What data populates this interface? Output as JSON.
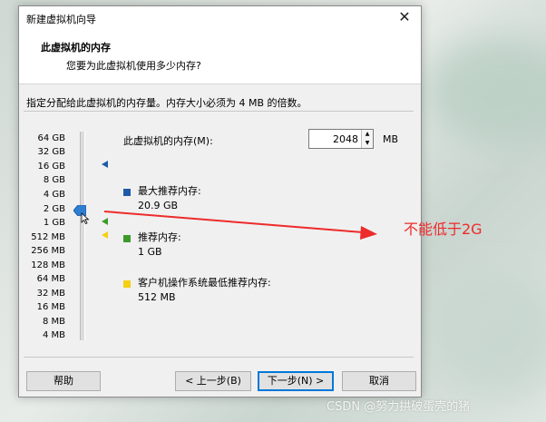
{
  "window": {
    "title": "新建虚拟机向导"
  },
  "header": {
    "title": "此虚拟机的内存",
    "subtitle": "您要为此虚拟机使用多少内存?"
  },
  "instruction": "指定分配给此虚拟机的内存量。内存大小必须为 4 MB 的倍数。",
  "scale_labels": [
    "64 GB",
    "32 GB",
    "16 GB",
    "8 GB",
    "4 GB",
    "2 GB",
    "1 GB",
    "512 MB",
    "256 MB",
    "128 MB",
    "64 MB",
    "32 MB",
    "16 MB",
    "8 MB",
    "4 MB"
  ],
  "memory": {
    "label": "此虚拟机的内存(M):",
    "value": "2048",
    "unit": "MB"
  },
  "legend": [
    {
      "label": "最大推荐内存:",
      "value": "20.9 GB",
      "color": "#1e5aa8"
    },
    {
      "label": "推荐内存:",
      "value": "1 GB",
      "color": "#3c9a2b"
    },
    {
      "label": "客户机操作系统最低推荐内存:",
      "value": "512 MB",
      "color": "#f4d012"
    }
  ],
  "buttons": {
    "help": "帮助",
    "back": "< 上一步(B)",
    "next": "下一步(N) >",
    "cancel": "取消"
  },
  "annotation": {
    "text": "不能低于2G",
    "color": "#ee2b2b"
  },
  "watermark": "CSDN @努力拱破蛋壳的猪"
}
